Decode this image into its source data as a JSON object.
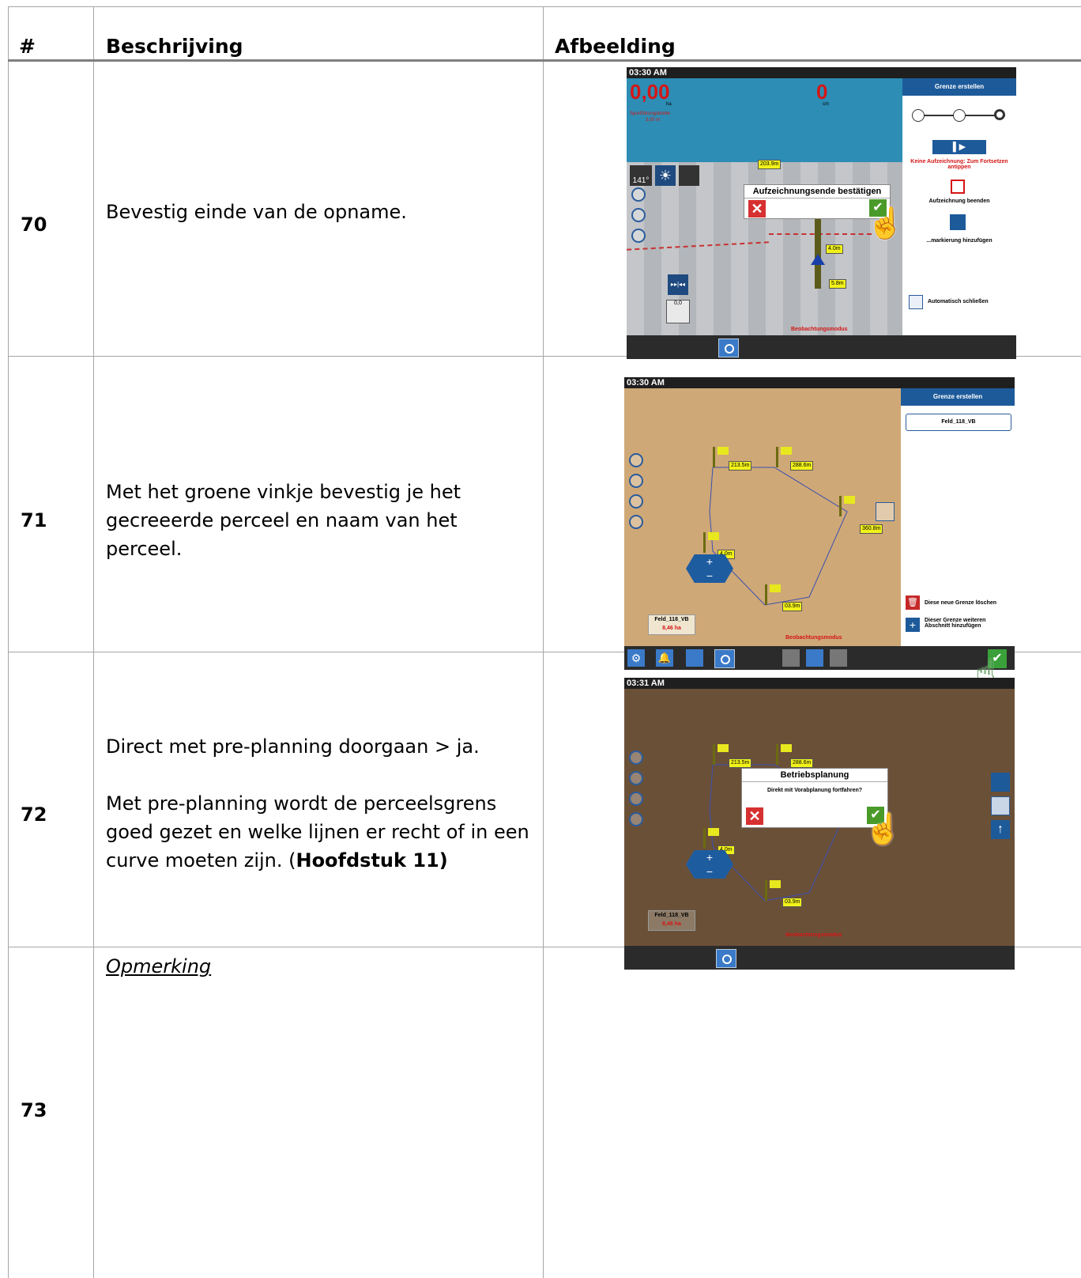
{
  "header": {
    "col_num": "#",
    "col_desc": "Beschrijving",
    "col_img": "Afbeelding"
  },
  "rows": [
    {
      "num": "70",
      "desc": "Bevestig einde van de opname."
    },
    {
      "num": "71",
      "desc": "Met het groene vinkje bevestig je het gecreeerde perceel en naam van het perceel."
    },
    {
      "num": "72",
      "desc1": "Direct met pre-planning doorgaan > ja.",
      "desc2": "Met pre-planning wordt de perceelsgrens goed gezet en welke lijnen er recht of in een curve moeten zijn. (",
      "desc2_bold": "Hoofdstuk 11)"
    },
    {
      "num": "73",
      "note": "Opmerking"
    }
  ],
  "shot70": {
    "time": "03:30 AM",
    "area_value": "0,00",
    "area_unit": "ha",
    "speed_value": "0",
    "speed_unit": "cm",
    "width_label": "Spurführungsbreite",
    "width_value": "3,00 m",
    "panel_title": "Grenze erstellen",
    "status_msg": "Keine Aufzeichnung: Zum Fortsetzen antippen",
    "stop_label": "Aufzeichnung beenden",
    "marker_label": "...markierung hinzufügen",
    "autoclose_label": "Automatisch schließen",
    "dialog_title": "Aufzeichnungsende bestätigen",
    "heading": "141°",
    "mode": "Beobachtungsmodus",
    "tags": [
      "203.9m",
      "4.0m",
      "5.8m"
    ],
    "rate": "0,0"
  },
  "shot71": {
    "time": "03:30 AM",
    "panel_title": "Grenze erstellen",
    "field_name": "Feld_118_VB",
    "delete_label": "Diese neue Grenze löschen",
    "add_label": "Dieser Grenze weiteren Abschnitt hinzufügen",
    "map_field": "Feld_118_VB",
    "map_area": "8,46 ha",
    "mode": "Beobachtungsmodus",
    "tags": [
      "213.5m",
      "288.6m",
      "360.8m",
      "4.0m",
      "03.9m"
    ]
  },
  "shot72": {
    "time": "03:31 AM",
    "dialog_title": "Betriebsplanung",
    "dialog_msg": "Direkt mit Vorabplanung fortfahren?",
    "map_field": "Feld_118_VB",
    "map_area": "8,46 ha",
    "mode": "Beobachtungsmodus",
    "tags": [
      "213.5m",
      "288.6m",
      "4.0m",
      "03.9m"
    ]
  },
  "icons": [
    "check-icon",
    "close-icon",
    "hand-pointer-icon",
    "camera-icon",
    "gear-icon",
    "bell-icon",
    "trash-icon",
    "plus-icon",
    "play-icon",
    "stop-icon",
    "flag-icon"
  ]
}
